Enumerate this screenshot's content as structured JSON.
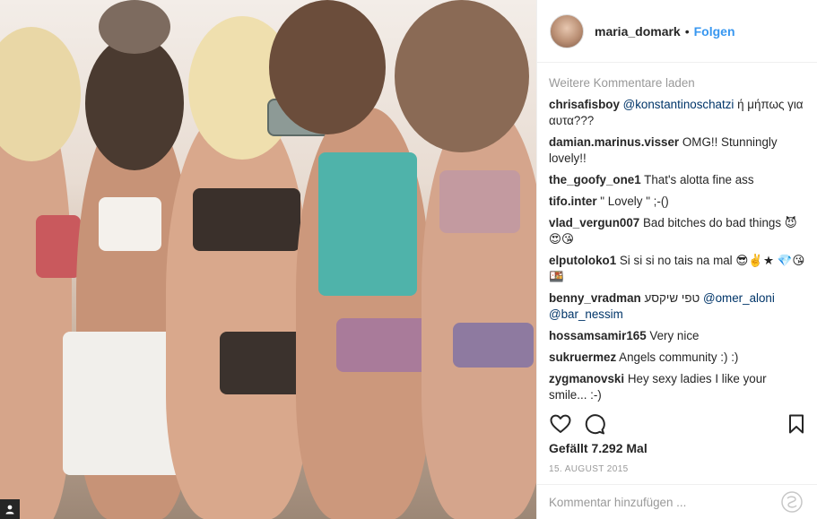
{
  "header": {
    "username": "maria_domark",
    "separator": "•",
    "follow_label": "Folgen"
  },
  "comments_panel": {
    "load_more": "Weitere Kommentare laden",
    "items": [
      {
        "user": "chrisafisboy",
        "mention": "@konstantinoschatzi",
        "text": " ή μήπως για αυτα???"
      },
      {
        "user": "damian.marinus.visser",
        "text": "OMG!! Stunningly lovely!!"
      },
      {
        "user": "the_goofy_one1",
        "text": "That's alotta fine ass"
      },
      {
        "user": "tifo.inter",
        "text": "\" Lovely \" ;-()"
      },
      {
        "user": "vlad_vergun007",
        "text": "Bad bitches do bad things 😈😍😘"
      },
      {
        "user": "elputoloko1",
        "text": "Si si si no tais na mal 😎✌️★ 💎😘🍱"
      },
      {
        "user": "benny_vradman",
        "text": "טפי שיקסע ",
        "mention": "@omer_aloni",
        "mention2": "@bar_nessim"
      },
      {
        "user": "hossamsamir165",
        "text": "Very nice"
      },
      {
        "user": "sukruermez",
        "text": "Angels community :) :)"
      },
      {
        "user": "zygmanovski",
        "text": "Hey sexy ladies I like your smile... :-)"
      }
    ]
  },
  "actions": {
    "like_icon": "heart-icon",
    "comment_icon": "comment-icon",
    "save_icon": "bookmark-icon"
  },
  "likes_label": "Gefällt 7.292 Mal",
  "date_label": "15. AUGUST 2015",
  "add_comment": {
    "placeholder": "Kommentar hinzufügen ..."
  }
}
